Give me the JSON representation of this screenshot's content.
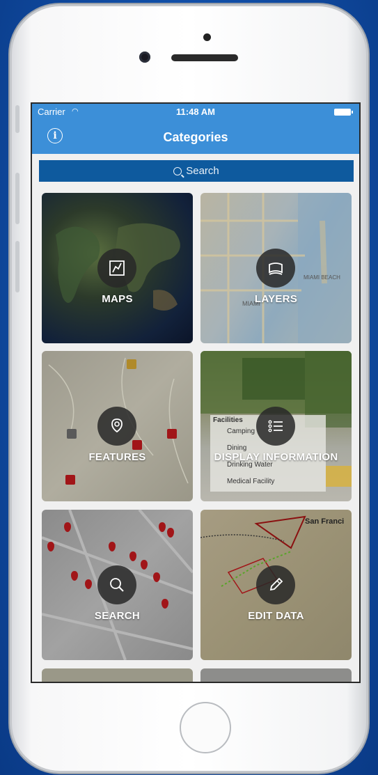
{
  "status_bar": {
    "carrier": "Carrier",
    "time": "11:48 AM"
  },
  "nav": {
    "title": "Categories"
  },
  "search": {
    "placeholder": "Search"
  },
  "tiles": [
    {
      "label": "MAPS",
      "icon": "map-icon"
    },
    {
      "label": "LAYERS",
      "icon": "layers-icon"
    },
    {
      "label": "FEATURES",
      "icon": "map-pin-icon"
    },
    {
      "label": "DISPLAY INFORMATION",
      "icon": "list-icon"
    },
    {
      "label": "SEARCH",
      "icon": "search-icon"
    },
    {
      "label": "EDIT DATA",
      "icon": "pencil-icon"
    }
  ],
  "legend": {
    "title": "Facilities",
    "items": [
      "Camping",
      "Dining",
      "Drinking Water",
      "Medical Facility"
    ]
  },
  "map_text": {
    "miami": "MIAMI",
    "miami_beach": "MIAMI BEACH",
    "san_francisco": "San Franci"
  },
  "colors": {
    "nav_bar": "#3c8fd8",
    "search_bar": "#0e5a9e",
    "pin": "#a11518"
  }
}
